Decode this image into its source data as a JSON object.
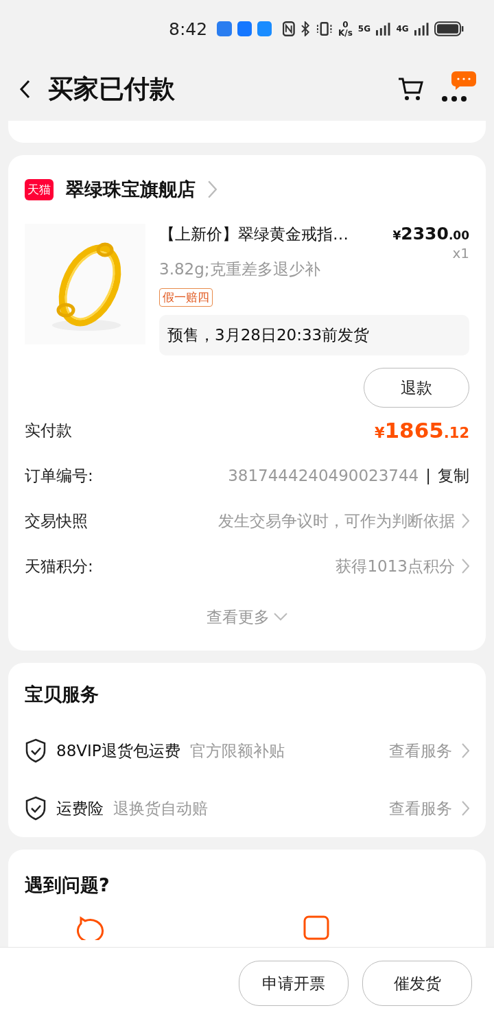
{
  "status_bar": {
    "time": "8:42",
    "net_speed_value": "0",
    "net_speed_unit": "K/s",
    "network_1": "5G",
    "network_2": "4G"
  },
  "header": {
    "title": "买家已付款"
  },
  "store": {
    "badge": "天猫",
    "name": "翠绿珠宝旗舰店"
  },
  "product": {
    "kind": "picture",
    "title": "【上新价】翠绿黄金戒指…",
    "price_symbol": "¥",
    "price_int": "2330",
    "price_dec": ".00",
    "quantity": "x1",
    "spec": "3.82g;克重差多退少补",
    "tag": "假一赔四",
    "shipping_note": "预售，3月28日20:33前发货",
    "refund_button": "退款"
  },
  "details": [
    {
      "kind": "price",
      "label": "实付款",
      "symbol": "¥",
      "int": "1865",
      "dec": ".12"
    },
    {
      "kind": "copy",
      "label": "订单编号:",
      "value": "3817444240490023744",
      "separator": "|",
      "action": "复制"
    },
    {
      "kind": "link",
      "label": "交易快照",
      "value": "发生交易争议时，可作为判断依据"
    },
    {
      "kind": "link",
      "label": "天猫积分:",
      "value": "获得1013点积分"
    }
  ],
  "more": "查看更多",
  "services": {
    "title": "宝贝服务",
    "items": [
      {
        "name": "88VIP退货包运费",
        "note": "官方限额补贴",
        "action": "查看服务"
      },
      {
        "name": "运费险",
        "note": "退换货自动赔",
        "action": "查看服务"
      }
    ]
  },
  "problems": {
    "title": "遇到问题?"
  },
  "bottom_buttons": [
    "申请开票",
    "催发货"
  ]
}
